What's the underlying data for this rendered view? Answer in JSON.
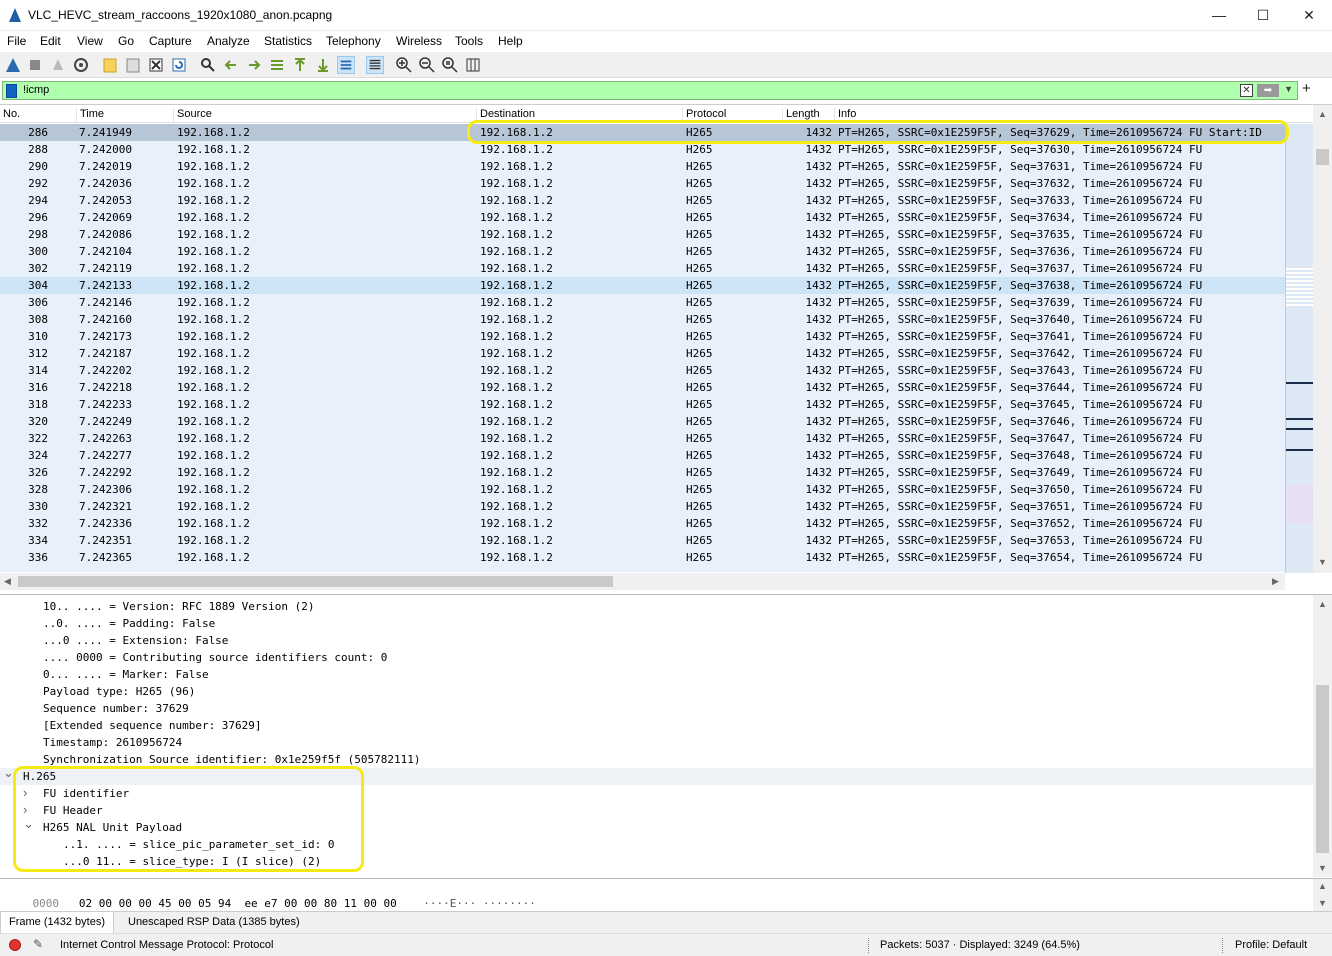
{
  "window": {
    "title": "VLC_HEVC_stream_raccoons_1920x1080_anon.pcapng",
    "minimize": "—",
    "maximize": "☐",
    "close": "✕"
  },
  "menu": [
    "File",
    "Edit",
    "View",
    "Go",
    "Capture",
    "Analyze",
    "Statistics",
    "Telephony",
    "Wireless",
    "Tools",
    "Help"
  ],
  "filter": {
    "value": "!icmp"
  },
  "columns": [
    "No.",
    "Time",
    "Source",
    "Destination",
    "Protocol",
    "Length",
    "Info"
  ],
  "packets": [
    {
      "no": "286",
      "time": "7.241949",
      "src": "192.168.1.2",
      "dst": "192.168.1.2",
      "proto": "H265",
      "len": "1432",
      "info": "PT=H265, SSRC=0x1E259F5F, Seq=37629, Time=2610956724 FU Start:ID"
    },
    {
      "no": "288",
      "time": "7.242000",
      "src": "192.168.1.2",
      "dst": "192.168.1.2",
      "proto": "H265",
      "len": "1432",
      "info": "PT=H265, SSRC=0x1E259F5F, Seq=37630, Time=2610956724 FU"
    },
    {
      "no": "290",
      "time": "7.242019",
      "src": "192.168.1.2",
      "dst": "192.168.1.2",
      "proto": "H265",
      "len": "1432",
      "info": "PT=H265, SSRC=0x1E259F5F, Seq=37631, Time=2610956724 FU"
    },
    {
      "no": "292",
      "time": "7.242036",
      "src": "192.168.1.2",
      "dst": "192.168.1.2",
      "proto": "H265",
      "len": "1432",
      "info": "PT=H265, SSRC=0x1E259F5F, Seq=37632, Time=2610956724 FU"
    },
    {
      "no": "294",
      "time": "7.242053",
      "src": "192.168.1.2",
      "dst": "192.168.1.2",
      "proto": "H265",
      "len": "1432",
      "info": "PT=H265, SSRC=0x1E259F5F, Seq=37633, Time=2610956724 FU"
    },
    {
      "no": "296",
      "time": "7.242069",
      "src": "192.168.1.2",
      "dst": "192.168.1.2",
      "proto": "H265",
      "len": "1432",
      "info": "PT=H265, SSRC=0x1E259F5F, Seq=37634, Time=2610956724 FU"
    },
    {
      "no": "298",
      "time": "7.242086",
      "src": "192.168.1.2",
      "dst": "192.168.1.2",
      "proto": "H265",
      "len": "1432",
      "info": "PT=H265, SSRC=0x1E259F5F, Seq=37635, Time=2610956724 FU"
    },
    {
      "no": "300",
      "time": "7.242104",
      "src": "192.168.1.2",
      "dst": "192.168.1.2",
      "proto": "H265",
      "len": "1432",
      "info": "PT=H265, SSRC=0x1E259F5F, Seq=37636, Time=2610956724 FU"
    },
    {
      "no": "302",
      "time": "7.242119",
      "src": "192.168.1.2",
      "dst": "192.168.1.2",
      "proto": "H265",
      "len": "1432",
      "info": "PT=H265, SSRC=0x1E259F5F, Seq=37637, Time=2610956724 FU"
    },
    {
      "no": "304",
      "time": "7.242133",
      "src": "192.168.1.2",
      "dst": "192.168.1.2",
      "proto": "H265",
      "len": "1432",
      "info": "PT=H265, SSRC=0x1E259F5F, Seq=37638, Time=2610956724 FU"
    },
    {
      "no": "306",
      "time": "7.242146",
      "src": "192.168.1.2",
      "dst": "192.168.1.2",
      "proto": "H265",
      "len": "1432",
      "info": "PT=H265, SSRC=0x1E259F5F, Seq=37639, Time=2610956724 FU"
    },
    {
      "no": "308",
      "time": "7.242160",
      "src": "192.168.1.2",
      "dst": "192.168.1.2",
      "proto": "H265",
      "len": "1432",
      "info": "PT=H265, SSRC=0x1E259F5F, Seq=37640, Time=2610956724 FU"
    },
    {
      "no": "310",
      "time": "7.242173",
      "src": "192.168.1.2",
      "dst": "192.168.1.2",
      "proto": "H265",
      "len": "1432",
      "info": "PT=H265, SSRC=0x1E259F5F, Seq=37641, Time=2610956724 FU"
    },
    {
      "no": "312",
      "time": "7.242187",
      "src": "192.168.1.2",
      "dst": "192.168.1.2",
      "proto": "H265",
      "len": "1432",
      "info": "PT=H265, SSRC=0x1E259F5F, Seq=37642, Time=2610956724 FU"
    },
    {
      "no": "314",
      "time": "7.242202",
      "src": "192.168.1.2",
      "dst": "192.168.1.2",
      "proto": "H265",
      "len": "1432",
      "info": "PT=H265, SSRC=0x1E259F5F, Seq=37643, Time=2610956724 FU"
    },
    {
      "no": "316",
      "time": "7.242218",
      "src": "192.168.1.2",
      "dst": "192.168.1.2",
      "proto": "H265",
      "len": "1432",
      "info": "PT=H265, SSRC=0x1E259F5F, Seq=37644, Time=2610956724 FU"
    },
    {
      "no": "318",
      "time": "7.242233",
      "src": "192.168.1.2",
      "dst": "192.168.1.2",
      "proto": "H265",
      "len": "1432",
      "info": "PT=H265, SSRC=0x1E259F5F, Seq=37645, Time=2610956724 FU"
    },
    {
      "no": "320",
      "time": "7.242249",
      "src": "192.168.1.2",
      "dst": "192.168.1.2",
      "proto": "H265",
      "len": "1432",
      "info": "PT=H265, SSRC=0x1E259F5F, Seq=37646, Time=2610956724 FU"
    },
    {
      "no": "322",
      "time": "7.242263",
      "src": "192.168.1.2",
      "dst": "192.168.1.2",
      "proto": "H265",
      "len": "1432",
      "info": "PT=H265, SSRC=0x1E259F5F, Seq=37647, Time=2610956724 FU"
    },
    {
      "no": "324",
      "time": "7.242277",
      "src": "192.168.1.2",
      "dst": "192.168.1.2",
      "proto": "H265",
      "len": "1432",
      "info": "PT=H265, SSRC=0x1E259F5F, Seq=37648, Time=2610956724 FU"
    },
    {
      "no": "326",
      "time": "7.242292",
      "src": "192.168.1.2",
      "dst": "192.168.1.2",
      "proto": "H265",
      "len": "1432",
      "info": "PT=H265, SSRC=0x1E259F5F, Seq=37649, Time=2610956724 FU"
    },
    {
      "no": "328",
      "time": "7.242306",
      "src": "192.168.1.2",
      "dst": "192.168.1.2",
      "proto": "H265",
      "len": "1432",
      "info": "PT=H265, SSRC=0x1E259F5F, Seq=37650, Time=2610956724 FU"
    },
    {
      "no": "330",
      "time": "7.242321",
      "src": "192.168.1.2",
      "dst": "192.168.1.2",
      "proto": "H265",
      "len": "1432",
      "info": "PT=H265, SSRC=0x1E259F5F, Seq=37651, Time=2610956724 FU"
    },
    {
      "no": "332",
      "time": "7.242336",
      "src": "192.168.1.2",
      "dst": "192.168.1.2",
      "proto": "H265",
      "len": "1432",
      "info": "PT=H265, SSRC=0x1E259F5F, Seq=37652, Time=2610956724 FU"
    },
    {
      "no": "334",
      "time": "7.242351",
      "src": "192.168.1.2",
      "dst": "192.168.1.2",
      "proto": "H265",
      "len": "1432",
      "info": "PT=H265, SSRC=0x1E259F5F, Seq=37653, Time=2610956724 FU"
    },
    {
      "no": "336",
      "time": "7.242365",
      "src": "192.168.1.2",
      "dst": "192.168.1.2",
      "proto": "H265",
      "len": "1432",
      "info": "PT=H265, SSRC=0x1E259F5F, Seq=37654, Time=2610956724 FU"
    }
  ],
  "details": [
    {
      "indent": 1,
      "chevron": "",
      "text": "10.. .... = Version: RFC 1889 Version (2)"
    },
    {
      "indent": 1,
      "chevron": "",
      "text": "..0. .... = Padding: False"
    },
    {
      "indent": 1,
      "chevron": "",
      "text": "...0 .... = Extension: False"
    },
    {
      "indent": 1,
      "chevron": "",
      "text": ".... 0000 = Contributing source identifiers count: 0"
    },
    {
      "indent": 1,
      "chevron": "",
      "text": "0... .... = Marker: False"
    },
    {
      "indent": 1,
      "chevron": "",
      "text": "Payload type: H265 (96)"
    },
    {
      "indent": 1,
      "chevron": "",
      "text": "Sequence number: 37629"
    },
    {
      "indent": 1,
      "chevron": "",
      "text": "[Extended sequence number: 37629]"
    },
    {
      "indent": 1,
      "chevron": "",
      "text": "Timestamp: 2610956724"
    },
    {
      "indent": 1,
      "chevron": "",
      "text": "Synchronization Source identifier: 0x1e259f5f (505782111)"
    },
    {
      "indent": 0,
      "chevron": "open",
      "text": "H.265"
    },
    {
      "indent": 1,
      "chevron": "closed",
      "text": "FU identifier"
    },
    {
      "indent": 1,
      "chevron": "closed",
      "text": "FU Header"
    },
    {
      "indent": 1,
      "chevron": "open",
      "text": "H265 NAL Unit Payload"
    },
    {
      "indent": 2,
      "chevron": "",
      "text": "..1. .... = slice_pic_parameter_set_id: 0"
    },
    {
      "indent": 2,
      "chevron": "",
      "text": "...0 11.. = slice_type: I (I slice) (2)"
    }
  ],
  "bytes": {
    "offset": "0000",
    "hex": "02 00 00 00 45 00 05 94  ee e7 00 00 80 11 00 00",
    "ascii": "····E··· ········"
  },
  "tabs": [
    "Frame (1432 bytes)",
    "Unescaped RSP Data (1385 bytes)"
  ],
  "status": {
    "field": "Internet Control Message Protocol: Protocol",
    "packets": "Packets: 5037 · Displayed: 3249 (64.5%)",
    "profile": "Profile: Default"
  },
  "colors": {
    "row_bg": "#e7f0fb",
    "row_selected": "#b7c6d7",
    "highlight": "#f5ea12",
    "filter_ok": "#afffaf"
  }
}
